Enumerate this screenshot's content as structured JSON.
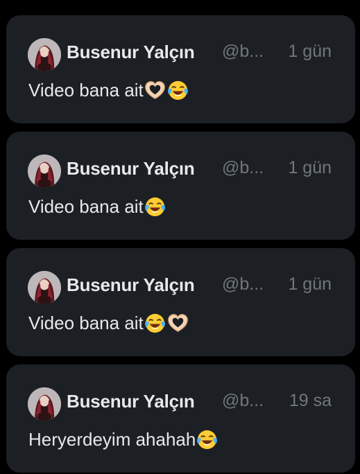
{
  "posts": [
    {
      "author_name": "Busenur Yalçın",
      "handle": "@b...",
      "time": "1 gün",
      "text": "Video bana ait",
      "emojis": [
        "heart-hands-emoji",
        "face-with-tears-of-joy-emoji"
      ]
    },
    {
      "author_name": "Busenur Yalçın",
      "handle": "@b...",
      "time": "1 gün",
      "text": "Video bana ait",
      "emojis": [
        "face-with-tears-of-joy-emoji"
      ]
    },
    {
      "author_name": "Busenur Yalçın",
      "handle": "@b...",
      "time": "1 gün",
      "text": "Video bana ait",
      "emojis": [
        "face-with-tears-of-joy-emoji",
        "heart-hands-emoji"
      ]
    },
    {
      "author_name": "Busenur Yalçın",
      "handle": "@b...",
      "time": "19 sa",
      "text": "Heryerdeyim ahahah",
      "emojis": [
        "face-with-tears-of-joy-emoji"
      ]
    }
  ],
  "colors": {
    "background": "#000000",
    "card": "#1c2024",
    "primary_text": "#e7e9ea",
    "secondary_text": "#71767b"
  }
}
